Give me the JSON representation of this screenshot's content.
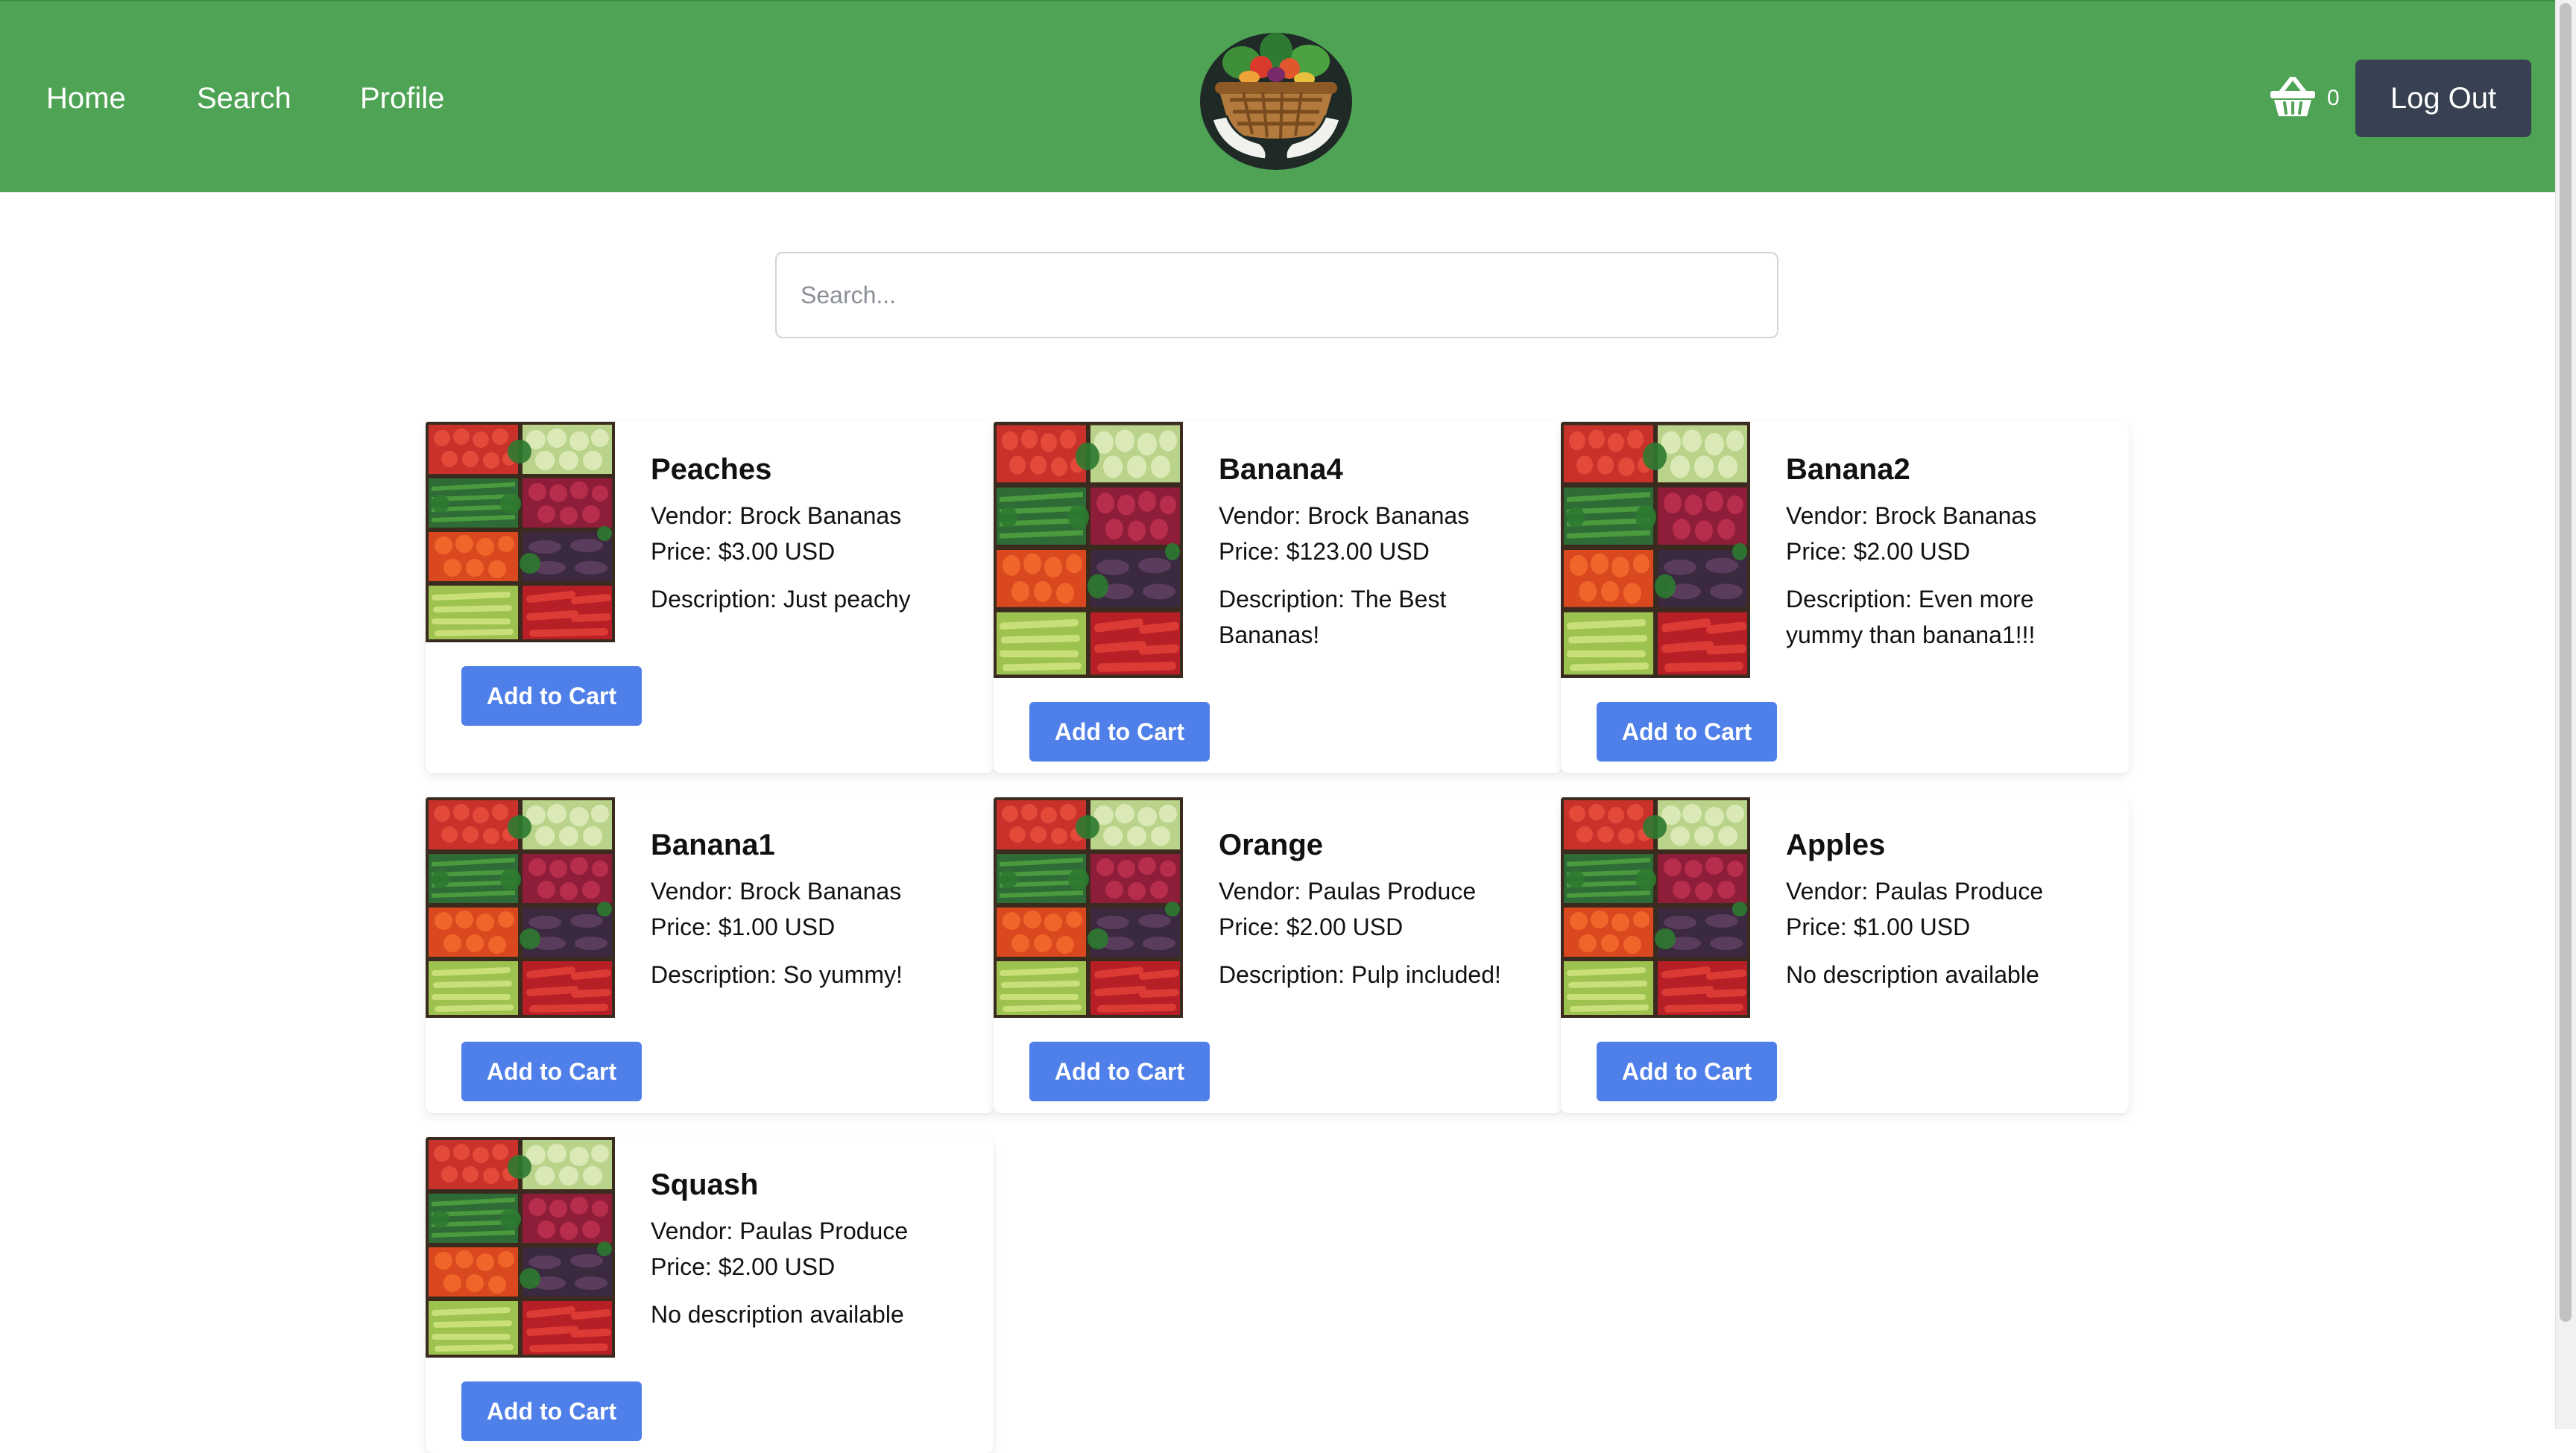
{
  "nav": {
    "home": "Home",
    "search": "Search",
    "profile": "Profile",
    "logo_icon": "basket-of-vegetables-logo",
    "cart_icon": "basket-icon",
    "cart_count": "0",
    "logout": "Log Out"
  },
  "search": {
    "placeholder": "Search...",
    "value": ""
  },
  "colors": {
    "navbar": "#4ea454",
    "button": "#4f7fe8",
    "logout": "#374151"
  },
  "products": [
    {
      "name": "Peaches",
      "vendor": "Vendor: Brock Bananas",
      "price": "Price: $3.00 USD",
      "description": "Description: Just peachy",
      "button": "Add to Cart",
      "image_icon": "produce-crates-image"
    },
    {
      "name": "Banana4",
      "vendor": "Vendor: Brock Bananas",
      "price": "Price: $123.00 USD",
      "description": "Description: The Best Bananas!",
      "button": "Add to Cart",
      "image_icon": "produce-crates-image"
    },
    {
      "name": "Banana2",
      "vendor": "Vendor: Brock Bananas",
      "price": "Price: $2.00 USD",
      "description": "Description: Even more yummy than banana1!!!",
      "button": "Add to Cart",
      "image_icon": "produce-crates-image"
    },
    {
      "name": "Banana1",
      "vendor": "Vendor: Brock Bananas",
      "price": "Price: $1.00 USD",
      "description": "Description: So yummy!",
      "button": "Add to Cart",
      "image_icon": "produce-crates-image"
    },
    {
      "name": "Orange",
      "vendor": "Vendor: Paulas Produce",
      "price": "Price: $2.00 USD",
      "description": "Description: Pulp included!",
      "button": "Add to Cart",
      "image_icon": "produce-crates-image"
    },
    {
      "name": "Apples",
      "vendor": "Vendor: Paulas Produce",
      "price": "Price: $1.00 USD",
      "description": "No description available",
      "button": "Add to Cart",
      "image_icon": "produce-crates-image"
    },
    {
      "name": "Squash",
      "vendor": "Vendor: Paulas Produce",
      "price": "Price: $2.00 USD",
      "description": "No description available",
      "button": "Add to Cart",
      "image_icon": "produce-crates-image"
    }
  ]
}
